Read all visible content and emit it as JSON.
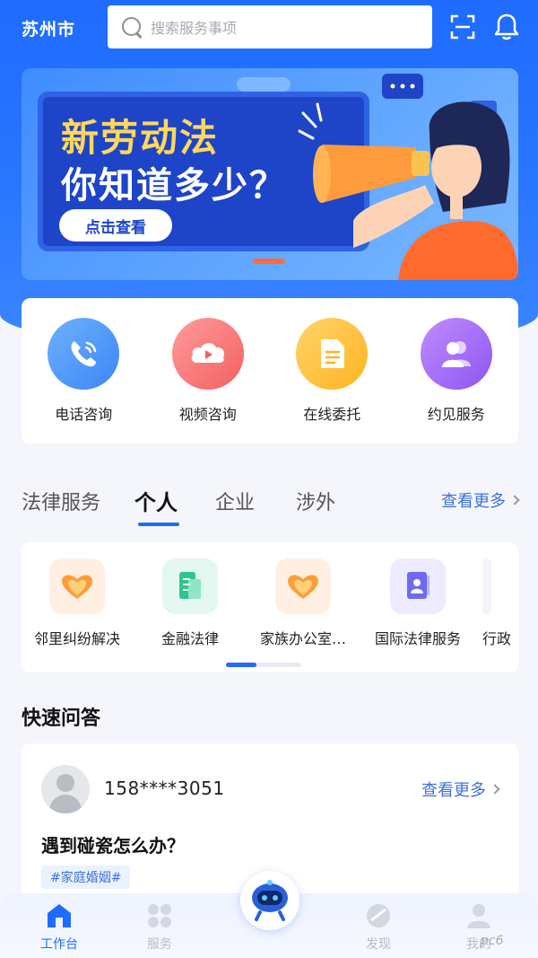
{
  "header": {
    "city": "苏州市",
    "search_placeholder": "搜索服务事项",
    "scan_icon": "scan-icon",
    "bell_icon": "bell-icon"
  },
  "banner": {
    "title_line1": "新劳动法",
    "title_line2": "你知道多少？",
    "button_label": "点击查看"
  },
  "quick_actions": [
    {
      "label": "电话咨询",
      "icon": "phone-icon",
      "color": "#4f9bff"
    },
    {
      "label": "视频咨询",
      "icon": "video-icon",
      "color": "#ff7b7b"
    },
    {
      "label": "在线委托",
      "icon": "document-icon",
      "color": "#ffc23d"
    },
    {
      "label": "约见服务",
      "icon": "people-icon",
      "color": "#a36bff"
    }
  ],
  "services": {
    "tabs": [
      {
        "label": "法律服务"
      },
      {
        "label": "个人"
      },
      {
        "label": "企业"
      },
      {
        "label": "涉外"
      }
    ],
    "active_tab": "个人",
    "more_label": "查看更多",
    "categories": [
      {
        "label": "邻里纠纷解决",
        "icon": "heart-hands-icon"
      },
      {
        "label": "金融法律",
        "icon": "finance-doc-icon"
      },
      {
        "label": "家族办公室…",
        "icon": "heart-hands-icon"
      },
      {
        "label": "国际法律服务",
        "icon": "passport-icon"
      },
      {
        "label": "行政"
      }
    ]
  },
  "qa": {
    "section_title": "快速问答",
    "phone": "158****3051",
    "more_label": "查看更多",
    "question": "遇到碰瓷怎么办？",
    "tag": "#家庭婚姻#"
  },
  "bottom_nav": [
    {
      "label": "工作台",
      "icon": "home-icon",
      "active": true
    },
    {
      "label": "服务",
      "icon": "grid-icon",
      "active": false
    },
    {
      "label": "发现",
      "icon": "discover-icon",
      "active": false
    },
    {
      "label": "我的",
      "icon": "user-icon",
      "active": false
    }
  ],
  "watermark": "pc6"
}
